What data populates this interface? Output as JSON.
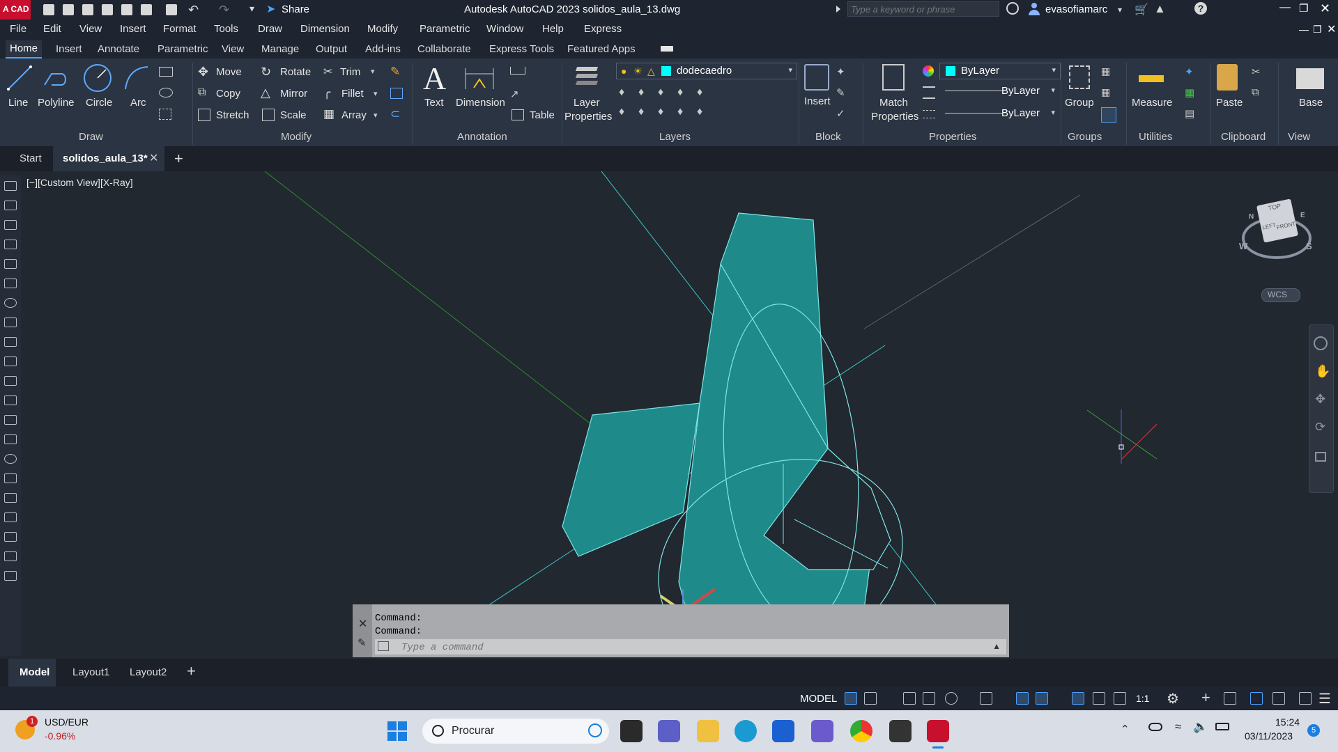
{
  "window": {
    "app_badge": "A CAD",
    "share_label": "Share",
    "title": "Autodesk AutoCAD 2023    solidos_aula_13.dwg",
    "search_placeholder": "Type a keyword or phrase",
    "user": "evasofiamarc"
  },
  "menu": [
    "File",
    "Edit",
    "View",
    "Insert",
    "Format",
    "Tools",
    "Draw",
    "Dimension",
    "Modify",
    "Parametric",
    "Window",
    "Help",
    "Express"
  ],
  "ribbon_tabs": [
    "Home",
    "Insert",
    "Annotate",
    "Parametric",
    "View",
    "Manage",
    "Output",
    "Add-ins",
    "Collaborate",
    "Express Tools",
    "Featured Apps"
  ],
  "draw": {
    "line": "Line",
    "polyline": "Polyline",
    "circle": "Circle",
    "arc": "Arc",
    "panel": "Draw"
  },
  "modify": {
    "move": "Move",
    "rotate": "Rotate",
    "trim": "Trim",
    "copy": "Copy",
    "mirror": "Mirror",
    "fillet": "Fillet",
    "stretch": "Stretch",
    "scale": "Scale",
    "array": "Array",
    "panel": "Modify"
  },
  "annotation": {
    "text": "Text",
    "dimension": "Dimension",
    "table": "Table",
    "panel": "Annotation"
  },
  "layers": {
    "layer_properties_1": "Layer",
    "layer_properties_2": "Properties",
    "current_layer": "dodecaedro",
    "panel": "Layers"
  },
  "block": {
    "insert": "Insert",
    "panel": "Block"
  },
  "properties": {
    "match_1": "Match",
    "match_2": "Properties",
    "color": "ByLayer",
    "linetype": "ByLayer",
    "lineweight": "ByLayer",
    "panel": "Properties"
  },
  "groups": {
    "group": "Group",
    "panel": "Groups"
  },
  "utilities": {
    "measure": "Measure",
    "panel": "Utilities"
  },
  "clipboard": {
    "paste": "Paste",
    "panel": "Clipboard"
  },
  "view_panel": {
    "base": "Base",
    "panel": "View"
  },
  "doc_tabs": {
    "start": "Start",
    "current": "solidos_aula_13*"
  },
  "viewport": {
    "label": "[−][Custom View][X-Ray]",
    "viewcube_top": "TOP",
    "viewcube_left": "LEFT",
    "viewcube_front": "FRONT",
    "compass_w": "W",
    "compass_s": "S",
    "compass_n": "N",
    "compass_e": "E",
    "wcs": "WCS"
  },
  "command": {
    "line1": "Command:",
    "line2": "Command:",
    "placeholder": "Type a command"
  },
  "layout_tabs": [
    "Model",
    "Layout1",
    "Layout2"
  ],
  "status": {
    "model": "MODEL",
    "scale": "1:1"
  },
  "taskbar": {
    "ticker": "USD/EUR",
    "ticker_change": "-0.96%",
    "badge": "1",
    "search": "Procurar",
    "time": "15:24",
    "date": "03/11/2023",
    "notif": "5"
  },
  "colors": {
    "accent": "#4aa3ff",
    "solid_fill": "#1f8a8a",
    "edge": "#7fe6e6",
    "viewport_bg": "#212830"
  }
}
